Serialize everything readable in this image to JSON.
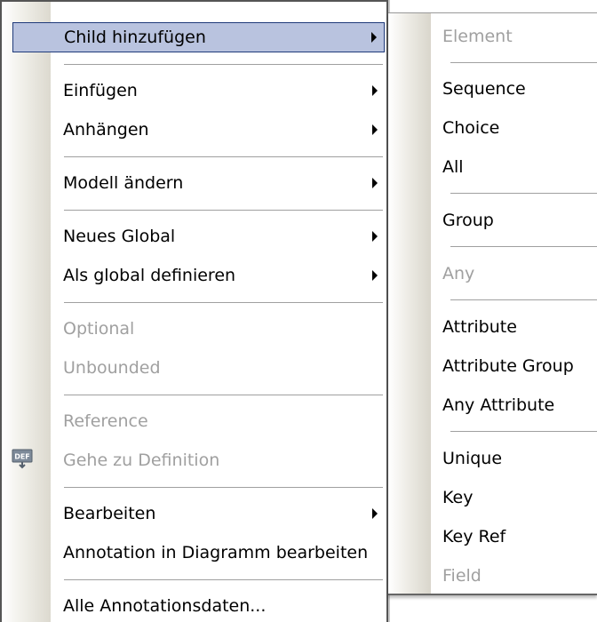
{
  "main_menu": {
    "items": [
      {
        "label": "Child hinzufügen",
        "submenu": true,
        "state": "highlighted"
      },
      {
        "label": "Einfügen",
        "submenu": true
      },
      {
        "label": "Anhängen",
        "submenu": true
      },
      {
        "label": "Modell ändern",
        "submenu": true
      },
      {
        "label": "Neues Global",
        "submenu": true
      },
      {
        "label": "Als global definieren",
        "submenu": true
      },
      {
        "label": "Optional",
        "state": "disabled"
      },
      {
        "label": "Unbounded",
        "state": "disabled"
      },
      {
        "label": "Reference",
        "state": "disabled"
      },
      {
        "label": "Gehe zu Definition",
        "state": "disabled",
        "icon": "def-icon"
      },
      {
        "label": "Bearbeiten",
        "submenu": true
      },
      {
        "label": "Annotation in Diagramm bearbeiten"
      },
      {
        "label": "Alle Annotationsdaten..."
      }
    ]
  },
  "sub_menu": {
    "items": [
      {
        "label": "Element",
        "state": "disabled"
      },
      {
        "label": "Sequence"
      },
      {
        "label": "Choice"
      },
      {
        "label": "All"
      },
      {
        "label": "Group"
      },
      {
        "label": "Any",
        "state": "disabled"
      },
      {
        "label": "Attribute"
      },
      {
        "label": "Attribute Group"
      },
      {
        "label": "Any Attribute"
      },
      {
        "label": "Unique"
      },
      {
        "label": "Key"
      },
      {
        "label": "Key Ref"
      },
      {
        "label": "Field",
        "state": "disabled"
      }
    ]
  },
  "colors": {
    "highlight_bg": "#b9c3df",
    "highlight_border": "#1f3a7a",
    "disabled_text": "#a0a0a0"
  }
}
